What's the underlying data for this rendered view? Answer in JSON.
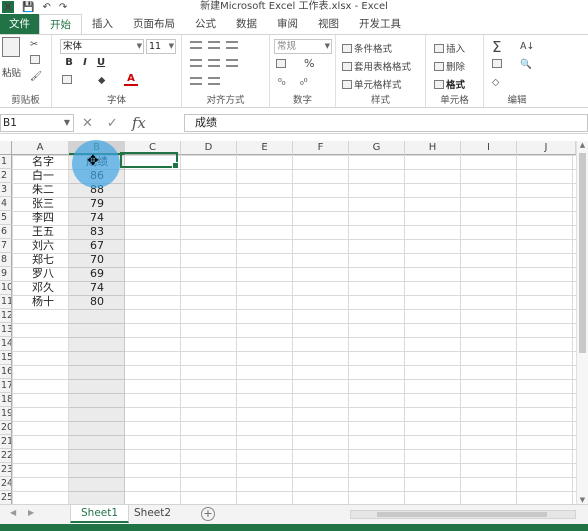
{
  "app": {
    "title": "新建Microsoft Excel 工作表.xlsx - Excel",
    "logo": "X"
  },
  "qat": {
    "save": "💾",
    "undo": "↶",
    "redo": "↷"
  },
  "tabs": [
    "文件",
    "开始",
    "插入",
    "页面布局",
    "公式",
    "数据",
    "审阅",
    "视图",
    "开发工具"
  ],
  "ribbon": {
    "clipboard": {
      "paste": "粘贴",
      "label": "剪贴板"
    },
    "font": {
      "name": "宋体",
      "size": "11",
      "bold": "B",
      "italic": "I",
      "underline": "U",
      "color_a": "A",
      "label": "字体"
    },
    "align": {
      "label": "对齐方式"
    },
    "number": {
      "format": "常规",
      "percent": "%",
      "label": "数字"
    },
    "styles": {
      "cond": "条件格式",
      "table": "套用表格格式",
      "cell": "单元格样式",
      "label": "样式"
    },
    "cells": {
      "insert": "插入",
      "delete": "删除",
      "format": "格式",
      "label": "单元格"
    },
    "editing": {
      "sum": "Σ",
      "label": "编辑"
    }
  },
  "formula": {
    "namebox": "B1",
    "value": "成绩",
    "fx": "fx"
  },
  "columns": [
    "A",
    "B",
    "C",
    "D",
    "E",
    "F",
    "G",
    "H",
    "I",
    "J"
  ],
  "rows": [
    "1",
    "2",
    "3",
    "4",
    "5",
    "6",
    "7",
    "8",
    "9",
    "10",
    "11",
    "12",
    "13",
    "14",
    "15",
    "16",
    "17",
    "18",
    "19",
    "20",
    "21",
    "22",
    "23",
    "24",
    "25"
  ],
  "data": {
    "A": [
      "名字",
      "白一",
      "朱二",
      "张三",
      "李四",
      "王五",
      "刘六",
      "郑七",
      "罗八",
      "邓久",
      "杨十"
    ],
    "B": [
      "成绩",
      "86",
      "88",
      "79",
      "74",
      "83",
      "67",
      "70",
      "69",
      "74",
      "80"
    ]
  },
  "sheets": [
    "Sheet1",
    "Sheet2"
  ],
  "accent": "#217346",
  "cursor_icon": "move-cursor"
}
